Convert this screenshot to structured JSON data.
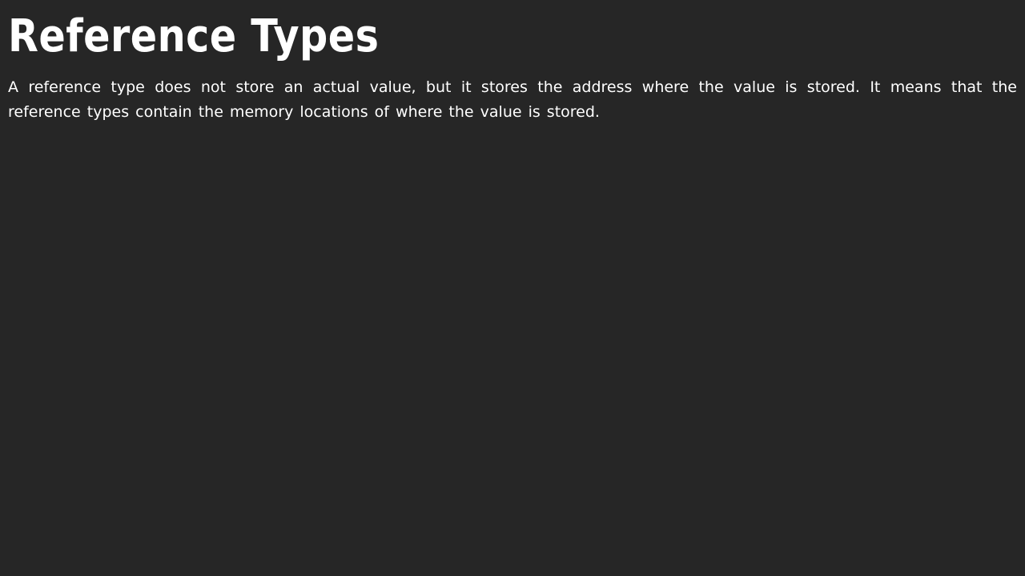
{
  "page": {
    "title": "Reference Types",
    "paragraph": "A reference type does not store an actual value, but it stores the address where the value is stored. It means that the reference types contain the memory locations of where the value is stored."
  },
  "colors": {
    "background": "#262626",
    "text": "#ffffff"
  }
}
